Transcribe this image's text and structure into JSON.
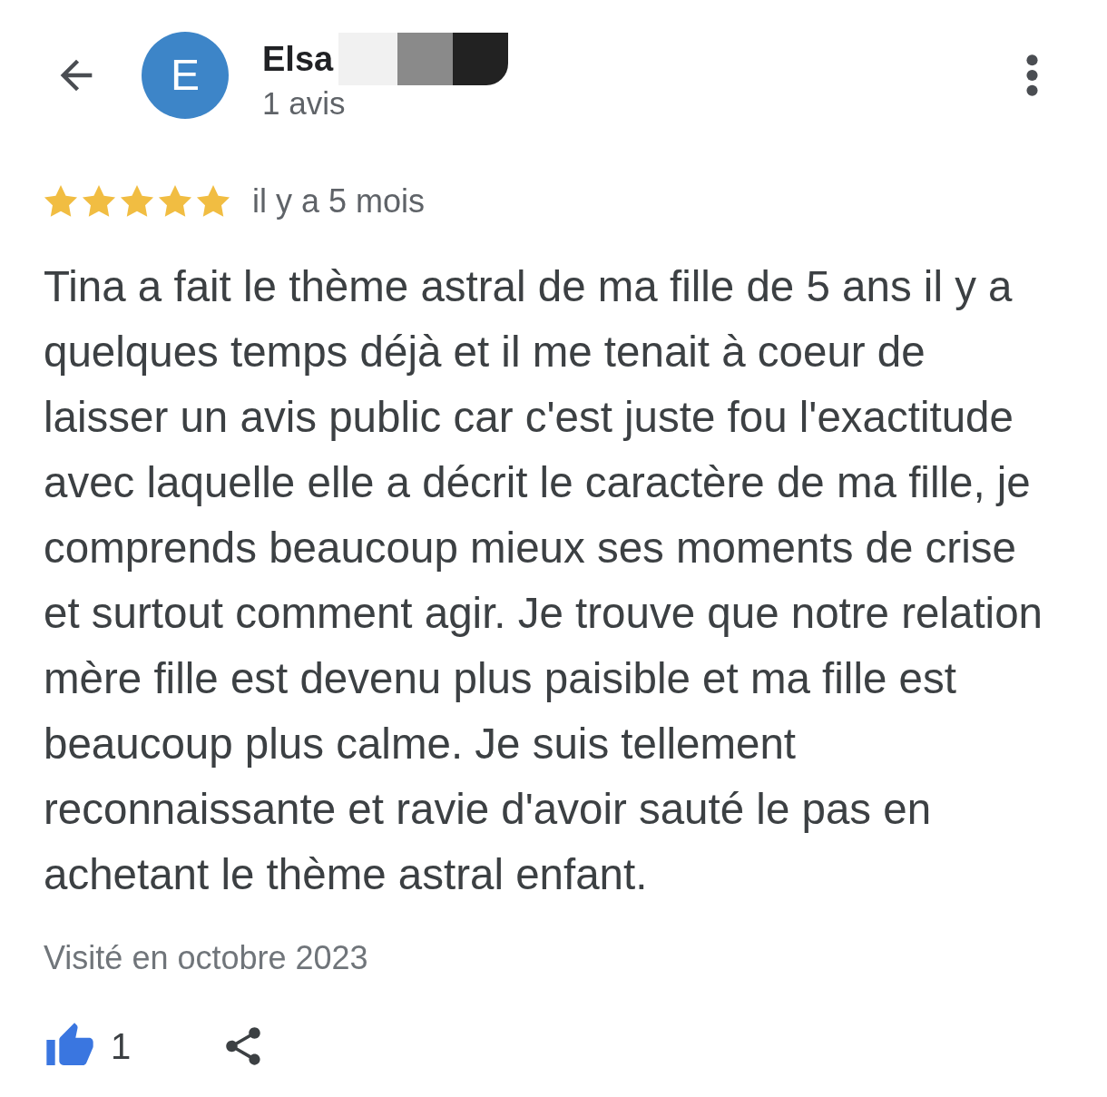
{
  "header": {
    "avatar_letter": "E",
    "name": "Elsa",
    "review_count": "1 avis"
  },
  "review": {
    "stars": 5,
    "time": "il y a 5 mois",
    "text": "Tina a fait le thème astral de ma fille de 5 ans il y a quelques temps déjà et il me tenait à coeur de laisser un avis public car c'est juste fou l'exactitude avec laquelle elle a décrit le caractère de ma fille, je comprends beaucoup mieux ses moments de crise et surtout comment agir. Je trouve que notre relation mère fille est devenu plus paisible et ma fille est beaucoup plus calme. Je suis tellement reconnaissante et ravie d'avoir sauté le pas en achetant le thème astral enfant.",
    "visited": "Visité en octobre 2023",
    "likes": "1",
    "liked": true
  }
}
